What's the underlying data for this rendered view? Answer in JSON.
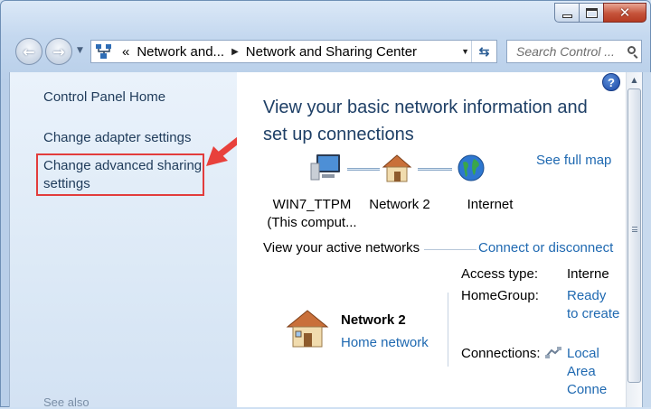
{
  "window": {
    "minimize_label": "",
    "accent_close": "#c5533a"
  },
  "navbar": {
    "address": {
      "overflow_chevron": "«",
      "crumb_1": "Network and...",
      "separator": "▶",
      "crumb_2": "Network and Sharing Center"
    },
    "search": {
      "placeholder": "Search Control ..."
    }
  },
  "left_pane": {
    "links": {
      "home": "Control Panel Home",
      "adapter": "Change adapter settings",
      "advanced": "Change advanced sharing settings"
    },
    "see_also": "See also"
  },
  "main": {
    "title": "View your basic network information and set up connections",
    "see_full_map": "See full map",
    "map": {
      "computer": {
        "line1": "WIN7_TTPM",
        "line2": "(This comput..."
      },
      "network": "Network  2",
      "internet": "Internet"
    },
    "active_networks": {
      "title": "View your active networks",
      "connect_link": "Connect or disconnect",
      "network_name": "Network  2",
      "network_type": "Home network",
      "access_type_label": "Access type:",
      "access_type_value": "Interne",
      "homegroup_label": "HomeGroup:",
      "homegroup_value": "Ready to create",
      "connections_label": "Connections:",
      "connections_value": "Local Area Conne"
    }
  },
  "colors": {
    "link": "#1f69b1",
    "title": "#1e3f66",
    "highlight_box": "#e23c3c"
  }
}
